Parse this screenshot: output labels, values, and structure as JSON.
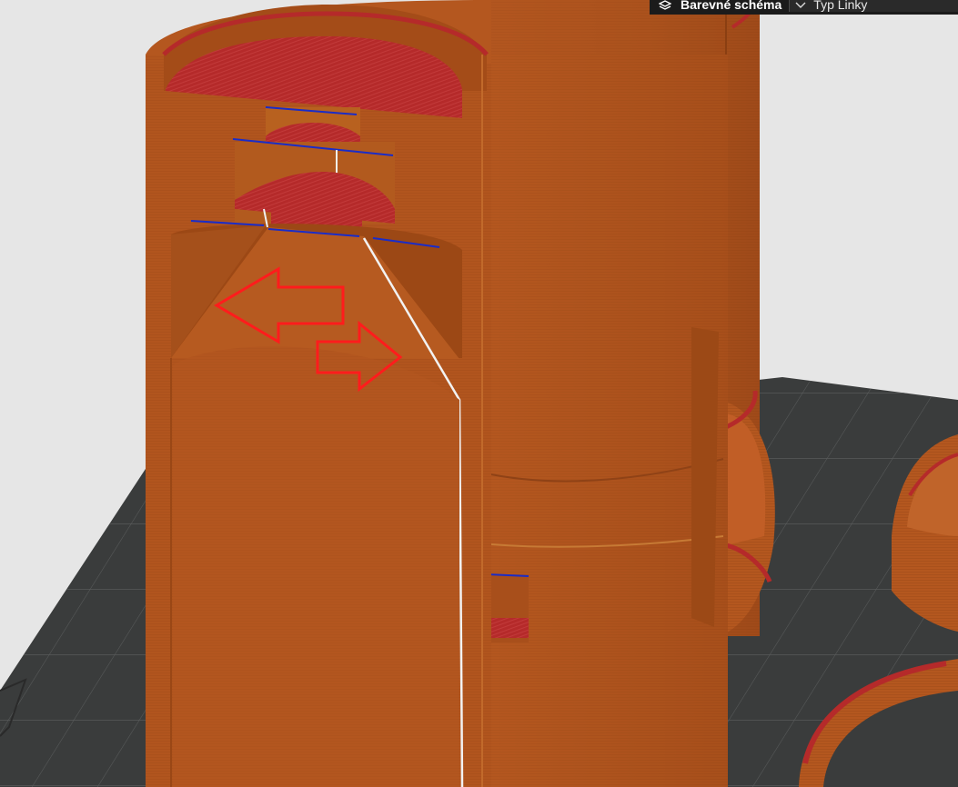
{
  "toolbar": {
    "color_scheme_label": "Barevné schéma",
    "line_type_label": "Typ Linky"
  },
  "viewport": {
    "background_color": "#e6e6e6",
    "bed_color": "#3a3c3c",
    "model_color": "#b3561f",
    "infill_color": "#b52a2a",
    "annotation_color": "#ff1c1c"
  }
}
